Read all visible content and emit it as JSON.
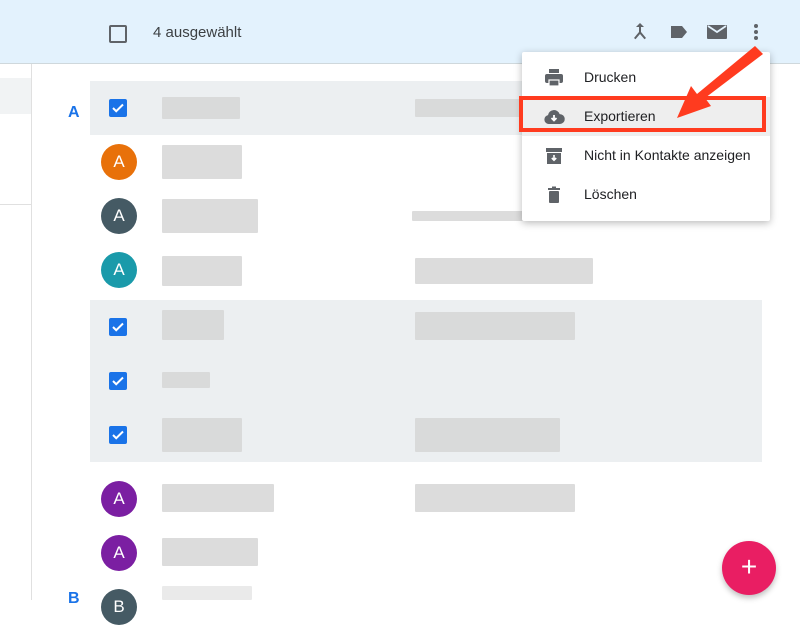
{
  "toolbar": {
    "selected_count": "4 ausgewählt",
    "icons": [
      "merge-icon",
      "label-icon",
      "mail-icon",
      "more-vert-icon"
    ]
  },
  "menu": {
    "items": [
      {
        "label": "Drucken",
        "icon": "print-icon"
      },
      {
        "label": "Exportieren",
        "icon": "cloud-download-icon",
        "highlighted": true
      },
      {
        "label": "Nicht in Kontakte anzeigen",
        "icon": "archive-icon"
      },
      {
        "label": "Löschen",
        "icon": "trash-icon"
      }
    ]
  },
  "contacts": {
    "sections": [
      "A",
      "B"
    ],
    "rows": [
      {
        "selected": true
      },
      {
        "selected": false,
        "initial": "A",
        "color": "#e8710a"
      },
      {
        "selected": false,
        "initial": "A",
        "color": "#455a64"
      },
      {
        "selected": false,
        "initial": "A",
        "color": "#1a9aaa"
      },
      {
        "selected": true
      },
      {
        "selected": true
      },
      {
        "selected": true
      },
      {
        "selected": false,
        "initial": "A",
        "color": "#7b1fa2"
      },
      {
        "selected": false,
        "initial": "A",
        "color": "#7b1fa2"
      },
      {
        "selected": false,
        "initial": "B",
        "color": "#455a64"
      }
    ]
  },
  "fab": {
    "label": "+"
  },
  "colors": {
    "accent": "#1a73e8",
    "toolbar_bg": "#e3f2fd",
    "fab": "#e91e63",
    "annotation": "#ff3b1f"
  }
}
